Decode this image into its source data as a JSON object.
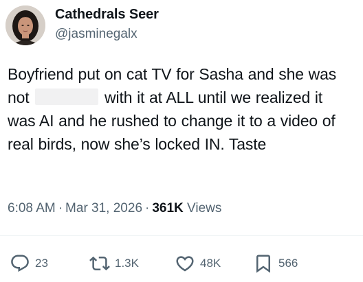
{
  "author": {
    "display_name": "Cathedrals Seer",
    "handle": "@jasminegalx"
  },
  "tweet": {
    "text_before_redaction": "Boyfriend put on cat TV for Sasha and she was not",
    "text_after_redaction": "with it at ALL until we realized it was AI and he rushed to change it to a video of real birds, now she’s locked IN. Taste"
  },
  "meta": {
    "time": "6:08 AM",
    "separator": "·",
    "date": "Mar 31, 2026",
    "views_count": "361K",
    "views_label": "Views"
  },
  "actions": {
    "replies": "23",
    "reposts": "1.3K",
    "likes": "48K",
    "bookmarks": "566"
  },
  "colors": {
    "text": "#0f1419",
    "secondary": "#536471",
    "divider": "#eff3f4"
  }
}
